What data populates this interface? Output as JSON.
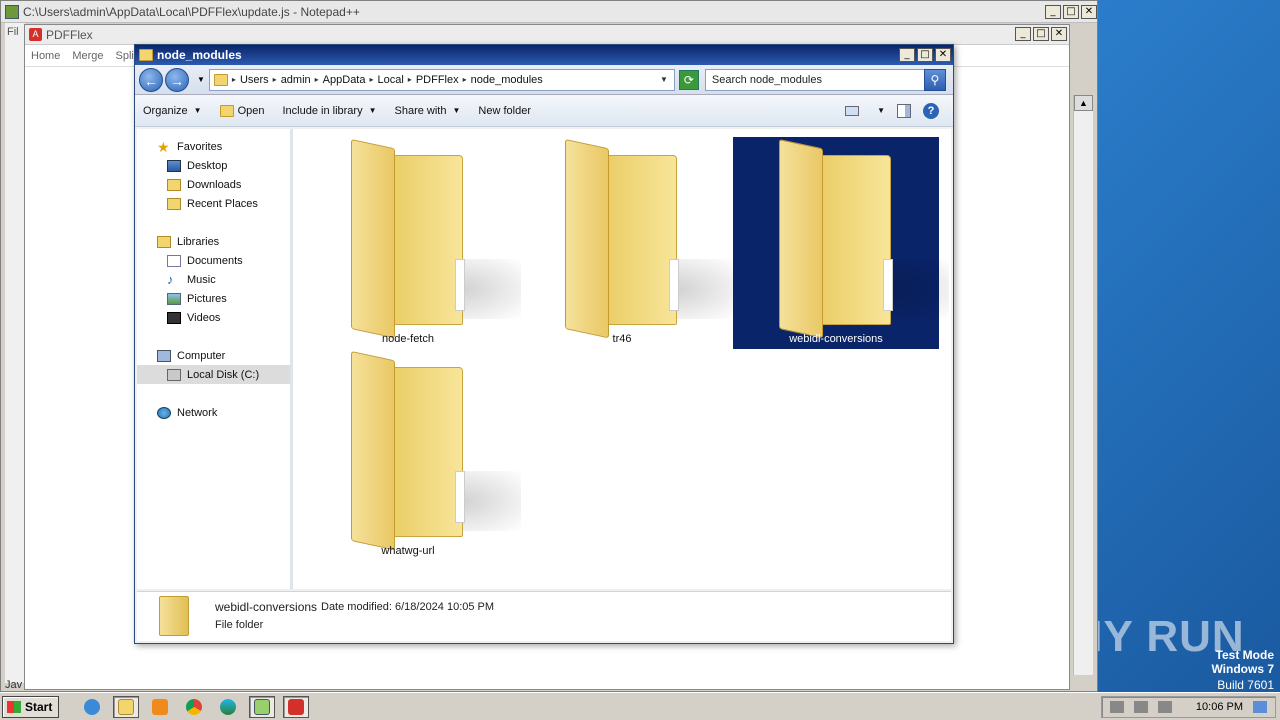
{
  "desktop": {
    "watermark_line1": "Test Mode",
    "watermark_line2": "Windows 7",
    "watermark_line3": "Build 7601",
    "brand": "ANY RUN"
  },
  "notepad": {
    "title": "C:\\Users\\admin\\AppData\\Local\\PDFFlex\\update.js - Notepad++",
    "menu_fragment": "Fil",
    "status_fragment": "Jav"
  },
  "pdfflex": {
    "title": "PDFFlex",
    "menu": [
      "Home",
      "Merge",
      "Split"
    ]
  },
  "explorer": {
    "title": "node_modules",
    "breadcrumb": [
      "Users",
      "admin",
      "AppData",
      "Local",
      "PDFFlex",
      "node_modules"
    ],
    "search_placeholder": "Search node_modules",
    "commands": {
      "organize": "Organize",
      "open": "Open",
      "include": "Include in library",
      "share": "Share with",
      "newfolder": "New folder"
    },
    "nav": {
      "favorites": "Favorites",
      "desktop": "Desktop",
      "downloads": "Downloads",
      "recent": "Recent Places",
      "libraries": "Libraries",
      "documents": "Documents",
      "music": "Music",
      "pictures": "Pictures",
      "videos": "Videos",
      "computer": "Computer",
      "localdisk": "Local Disk (C:)",
      "network": "Network"
    },
    "folders": [
      "node-fetch",
      "tr46",
      "webidl-conversions",
      "whatwg-url"
    ],
    "selected_folder": "webidl-conversions",
    "details": {
      "name": "webidl-conversions",
      "modified": "Date modified: 6/18/2024 10:05 PM",
      "type": "File folder"
    }
  },
  "taskbar": {
    "start": "Start",
    "clock": "10:06 PM"
  }
}
